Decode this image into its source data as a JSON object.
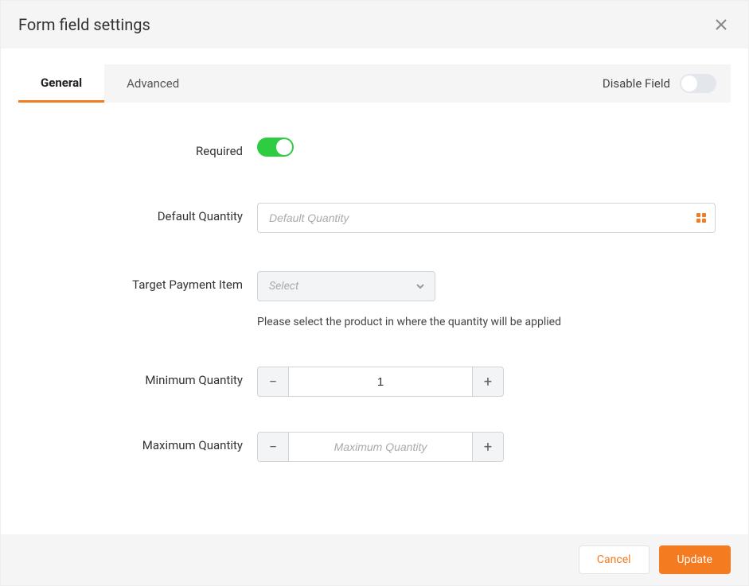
{
  "header": {
    "title": "Form field settings"
  },
  "tabs": {
    "general": "General",
    "advanced": "Advanced",
    "disable_label": "Disable Field"
  },
  "labels": {
    "required": "Required",
    "default_quantity": "Default Quantity",
    "target_payment_item": "Target Payment Item",
    "min_quantity": "Minimum Quantity",
    "max_quantity": "Maximum Quantity"
  },
  "inputs": {
    "default_quantity_placeholder": "Default Quantity",
    "target_select_placeholder": "Select",
    "target_helper": "Please select the product in where the quantity will be applied",
    "min_value": "1",
    "max_placeholder": "Maximum Quantity"
  },
  "footer": {
    "cancel": "Cancel",
    "update": "Update"
  }
}
